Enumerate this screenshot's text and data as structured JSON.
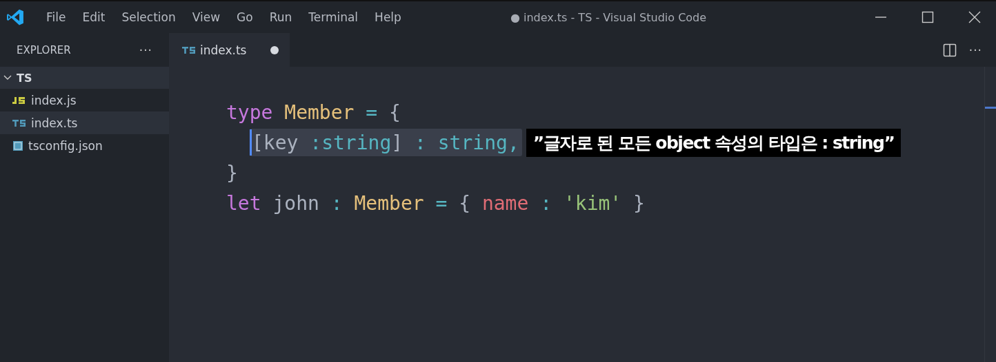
{
  "window": {
    "title": "● index.ts - TS - Visual Studio Code"
  },
  "menu": [
    "File",
    "Edit",
    "Selection",
    "View",
    "Go",
    "Run",
    "Terminal",
    "Help"
  ],
  "sidebar": {
    "title": "EXPLORER",
    "more": "···",
    "folder": {
      "name": "TS",
      "expanded": true,
      "children": [
        {
          "name": "index.js",
          "kind": "js",
          "selected": false
        },
        {
          "name": "index.ts",
          "kind": "ts",
          "selected": true
        },
        {
          "name": "tsconfig.json",
          "kind": "config",
          "selected": false
        }
      ]
    }
  },
  "tabs": [
    {
      "label": "index.ts",
      "kind": "ts",
      "modified": true,
      "selected": true
    }
  ],
  "editor_more": "···",
  "code": [
    {
      "highlighted": false,
      "tokens": [
        {
          "text": "type",
          "kind": "keyword"
        },
        {
          "text": " Member",
          "kind": "type"
        },
        {
          "text": " = ",
          "kind": "operator"
        },
        {
          "text": "{",
          "kind": "punct"
        }
      ],
      "children": [
        {
          "highlighted": true,
          "cursor": true,
          "tokens": [
            {
              "text": "[",
              "kind": "punct"
            },
            {
              "text": "key ",
              "kind": "plain"
            },
            {
              "text": ":string",
              "kind": "operator"
            },
            {
              "text": "] ",
              "kind": "punct"
            },
            {
              "text": ": string,",
              "kind": "operator"
            }
          ],
          "caption": "”글자로 된 모든 object 속성의 타입은 : string”"
        }
      ]
    },
    {
      "highlighted": false,
      "tokens": [
        {
          "text": "}",
          "kind": "punct"
        }
      ]
    },
    {
      "highlighted": false,
      "tokens": [
        {
          "text": "let",
          "kind": "keyword"
        },
        {
          "text": " john ",
          "kind": "plain"
        },
        {
          "text": ": ",
          "kind": "operator"
        },
        {
          "text": "Member",
          "kind": "type"
        },
        {
          "text": " = ",
          "kind": "operator"
        },
        {
          "text": "{ ",
          "kind": "punct"
        },
        {
          "text": "name",
          "kind": "property"
        },
        {
          "text": " : ",
          "kind": "operator"
        },
        {
          "text": "'kim'",
          "kind": "string"
        },
        {
          "text": " }",
          "kind": "punct"
        }
      ]
    }
  ]
}
